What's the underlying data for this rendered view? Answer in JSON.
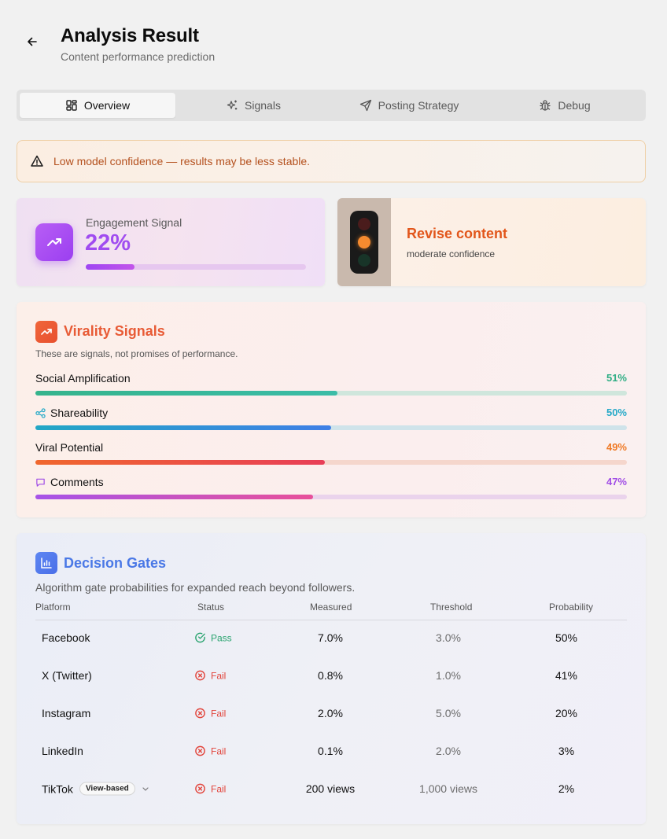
{
  "header": {
    "title": "Analysis Result",
    "subtitle": "Content performance prediction"
  },
  "tabs": [
    {
      "label": "Overview",
      "icon": "grid-icon",
      "active": true
    },
    {
      "label": "Signals",
      "icon": "sparkles-icon",
      "active": false
    },
    {
      "label": "Posting Strategy",
      "icon": "send-icon",
      "active": false
    },
    {
      "label": "Debug",
      "icon": "bug-icon",
      "active": false
    }
  ],
  "alert": {
    "text": "Low model confidence — results may be less stable.",
    "icon": "warning-triangle-icon"
  },
  "engagement": {
    "label": "Engagement Signal",
    "value": "22%",
    "progress": 0.22,
    "icon": "trending-up-icon"
  },
  "decision": {
    "title": "Revise content",
    "subtitle": "moderate confidence",
    "icon": "traffic-light-icon",
    "active_light": "amber"
  },
  "virality": {
    "title": "Virality Signals",
    "subtitle": "These are signals, not promises of performance.",
    "signals": [
      {
        "name": "Social Amplification",
        "pct": "51%",
        "value": 0.51,
        "icon": "",
        "pct_color": "#2fae85",
        "fill": "linear-gradient(90deg,#35b48c,#3bbca7)",
        "track": "#cfe6dc"
      },
      {
        "name": "Shareability",
        "pct": "50%",
        "value": 0.5,
        "icon": "share-icon",
        "pct_color": "#25a9c8",
        "fill": "linear-gradient(90deg,#22a7c5,#3f7fe6)",
        "track": "#cfe3ea"
      },
      {
        "name": "Viral Potential",
        "pct": "49%",
        "value": 0.49,
        "icon": "",
        "pct_color": "#ef7a26",
        "fill": "linear-gradient(90deg,#f0672d,#e83e57)",
        "track": "#f5d6cc"
      },
      {
        "name": "Comments",
        "pct": "47%",
        "value": 0.47,
        "icon": "comment-icon",
        "pct_color": "#a14ee6",
        "fill": "linear-gradient(90deg,#a653e8,#e8509a)",
        "track": "#ead3ec"
      }
    ]
  },
  "gates": {
    "title": "Decision Gates",
    "subtitle": "Algorithm gate probabilities for expanded reach beyond followers.",
    "columns": [
      "Platform",
      "Status",
      "Measured",
      "Threshold",
      "Probability"
    ],
    "rows": [
      {
        "platform": "Facebook",
        "badge": "",
        "status": "Pass",
        "measured": "7.0%",
        "threshold": "3.0%",
        "probability": "50%"
      },
      {
        "platform": "X (Twitter)",
        "badge": "",
        "status": "Fail",
        "measured": "0.8%",
        "threshold": "1.0%",
        "probability": "41%"
      },
      {
        "platform": "Instagram",
        "badge": "",
        "status": "Fail",
        "measured": "2.0%",
        "threshold": "5.0%",
        "probability": "20%"
      },
      {
        "platform": "LinkedIn",
        "badge": "",
        "status": "Fail",
        "measured": "0.1%",
        "threshold": "2.0%",
        "probability": "3%"
      },
      {
        "platform": "TikTok",
        "badge": "View-based",
        "status": "Fail",
        "measured": "200 views",
        "threshold": "1,000 views",
        "probability": "2%"
      }
    ]
  }
}
